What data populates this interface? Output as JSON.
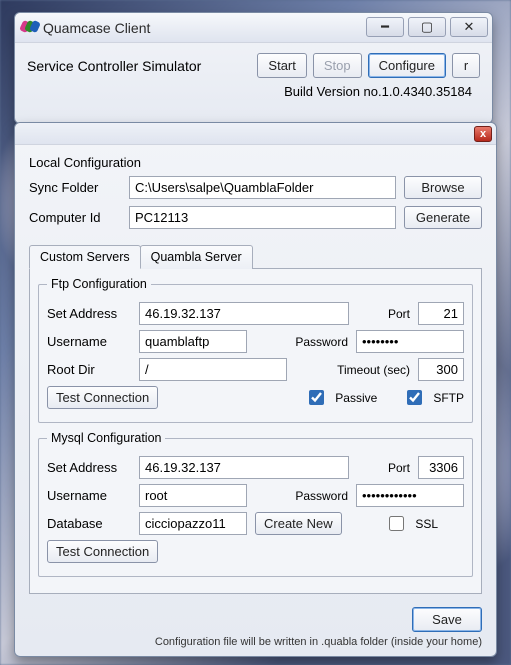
{
  "win1": {
    "title": "Quamcase Client",
    "scs": "Service Controller Simulator",
    "start": "Start",
    "stop": "Stop",
    "configure": "Configure",
    "r": "r",
    "build": "Build Version no.1.0.4340.35184"
  },
  "local": {
    "heading": "Local Configuration",
    "syncLabel": "Sync Folder",
    "syncValue": "C:\\Users\\salpe\\QuamblaFolder",
    "browse": "Browse",
    "compLabel": "Computer Id",
    "compValue": "PC12113",
    "generate": "Generate"
  },
  "tabs": {
    "custom": "Custom Servers",
    "quambla": "Quambla Server"
  },
  "ftp": {
    "legend": "Ftp Configuration",
    "addrLabel": "Set Address",
    "addrValue": "46.19.32.137",
    "portLabel": "Port",
    "portValue": "21",
    "userLabel": "Username",
    "userValue": "quamblaftp",
    "passLabel": "Password",
    "passValue": "••••••••",
    "rootLabel": "Root Dir",
    "rootValue": "/",
    "timeoutLabel": "Timeout (sec)",
    "timeoutValue": "300",
    "test": "Test Connection",
    "passive": "Passive",
    "sftp": "SFTP"
  },
  "mysql": {
    "legend": "Mysql Configuration",
    "addrLabel": "Set Address",
    "addrValue": "46.19.32.137",
    "portLabel": "Port",
    "portValue": "3306",
    "userLabel": "Username",
    "userValue": "root",
    "passLabel": "Password",
    "passValue": "••••••••••••",
    "dbLabel": "Database",
    "dbValue": "cicciopazzo11",
    "create": "Create New",
    "ssl": "SSL",
    "test": "Test Connection"
  },
  "bottom": {
    "save": "Save",
    "hint": "Configuration file will be written in .quabla folder (inside your home)"
  }
}
